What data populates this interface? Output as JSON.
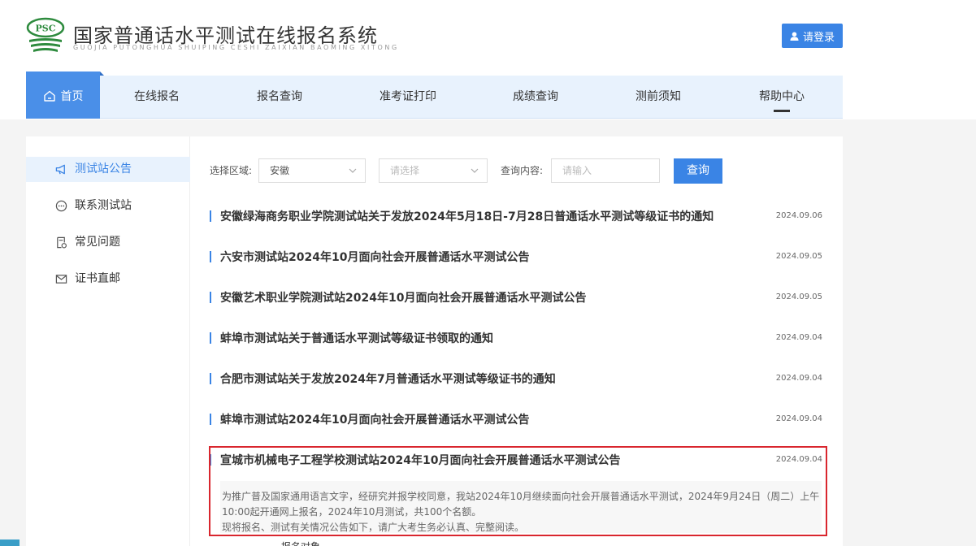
{
  "header": {
    "logo_mark": "PSC",
    "title": "国家普通话水平测试在线报名系统",
    "subtitle": "GUOJIA PUTONGHUA SHUIPING CESHI ZAIXIAN BAOMING XITONG",
    "login_label": "请登录"
  },
  "nav": {
    "items": [
      {
        "label": "首页"
      },
      {
        "label": "在线报名"
      },
      {
        "label": "报名查询"
      },
      {
        "label": "准考证打印"
      },
      {
        "label": "成绩查询"
      },
      {
        "label": "测前须知"
      },
      {
        "label": "帮助中心"
      }
    ]
  },
  "sidebar": {
    "items": [
      {
        "label": "测试站公告",
        "icon": "megaphone-icon"
      },
      {
        "label": "联系测试站",
        "icon": "chat-icon"
      },
      {
        "label": "常见问题",
        "icon": "document-question-icon"
      },
      {
        "label": "证书直邮",
        "icon": "mail-icon"
      }
    ]
  },
  "filters": {
    "region_label": "选择区域:",
    "province_value": "安徽",
    "city_placeholder": "请选择",
    "query_label": "查询内容:",
    "query_placeholder": "请输入",
    "search_label": "查询"
  },
  "news": [
    {
      "title": "安徽绿海商务职业学院测试站关于发放2024年5月18日-7月28日普通话水平测试等级证书的通知",
      "date": "2024.09.06"
    },
    {
      "title": "六安市测试站2024年10月面向社会开展普通话水平测试公告",
      "date": "2024.09.05"
    },
    {
      "title": "安徽艺术职业学院测试站2024年10月面向社会开展普通话水平测试公告",
      "date": "2024.09.05"
    },
    {
      "title": "蚌埠市测试站关于普通话水平测试等级证书领取的通知",
      "date": "2024.09.04"
    },
    {
      "title": "合肥市测试站关于发放2024年7月普通话水平测试等级证书的通知",
      "date": "2024.09.04"
    },
    {
      "title": "蚌埠市测试站2024年10月面向社会开展普通话水平测试公告",
      "date": "2024.09.04"
    },
    {
      "title": "宣城市机械电子工程学校测试站2024年10月面向社会开展普通话水平测试公告",
      "date": "2024.09.04"
    }
  ],
  "summary": {
    "line1": "为推广普及国家通用语言文字，经研究并报学校同意，我站2024年10月继续面向社会开展普通话水平测试，2024年9月24日（周二）上午",
    "line2": "10:00起开通网上报名，2024年10月测试，共100个名额。",
    "line3": "现将报名、测试有关情况公告如下，请广大考生务必认真、完整阅读。",
    "line4": "一、报名对象"
  },
  "colors": {
    "accent": "#3a84e5",
    "nav_bg": "#e8f2fd",
    "highlight_border": "#d9262e",
    "logo_green": "#2e8b3e"
  }
}
